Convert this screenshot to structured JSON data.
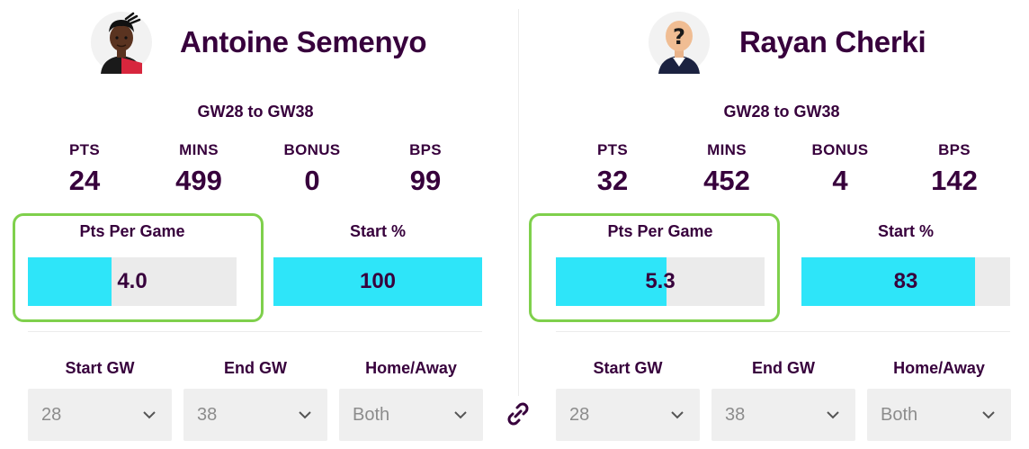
{
  "comparison": {
    "link_icon": "link-icon",
    "players": [
      {
        "name": "Antoine Semenyo",
        "avatar": "player-photo",
        "range": "GW28 to GW38",
        "stats": [
          {
            "label": "PTS",
            "value": "24"
          },
          {
            "label": "MINS",
            "value": "499"
          },
          {
            "label": "BONUS",
            "value": "0"
          },
          {
            "label": "BPS",
            "value": "99"
          }
        ],
        "ppg": {
          "label": "Pts Per Game",
          "value": "4.0",
          "fill_fraction": 0.4
        },
        "start_pct": {
          "label": "Start %",
          "value": "100",
          "fill_fraction": 1.0
        },
        "filters": {
          "start_gw": {
            "label": "Start GW",
            "value": "28"
          },
          "end_gw": {
            "label": "End GW",
            "value": "38"
          },
          "home_away": {
            "label": "Home/Away",
            "value": "Both"
          }
        }
      },
      {
        "name": "Rayan Cherki",
        "avatar": "unknown-player-question-mark",
        "range": "GW28 to GW38",
        "stats": [
          {
            "label": "PTS",
            "value": "32"
          },
          {
            "label": "MINS",
            "value": "452"
          },
          {
            "label": "BONUS",
            "value": "4"
          },
          {
            "label": "BPS",
            "value": "142"
          }
        ],
        "ppg": {
          "label": "Pts Per Game",
          "value": "5.3",
          "fill_fraction": 0.53
        },
        "start_pct": {
          "label": "Start %",
          "value": "83",
          "fill_fraction": 0.83
        },
        "filters": {
          "start_gw": {
            "label": "Start GW",
            "value": "28"
          },
          "end_gw": {
            "label": "End GW",
            "value": "38"
          },
          "home_away": {
            "label": "Home/Away",
            "value": "Both"
          }
        }
      }
    ],
    "colors": {
      "primary_text": "#37003c",
      "bar_fill": "#2ee5f9",
      "bar_track": "#ebebeb",
      "highlight_border": "#7fd04c",
      "select_bg": "#efefef"
    }
  }
}
